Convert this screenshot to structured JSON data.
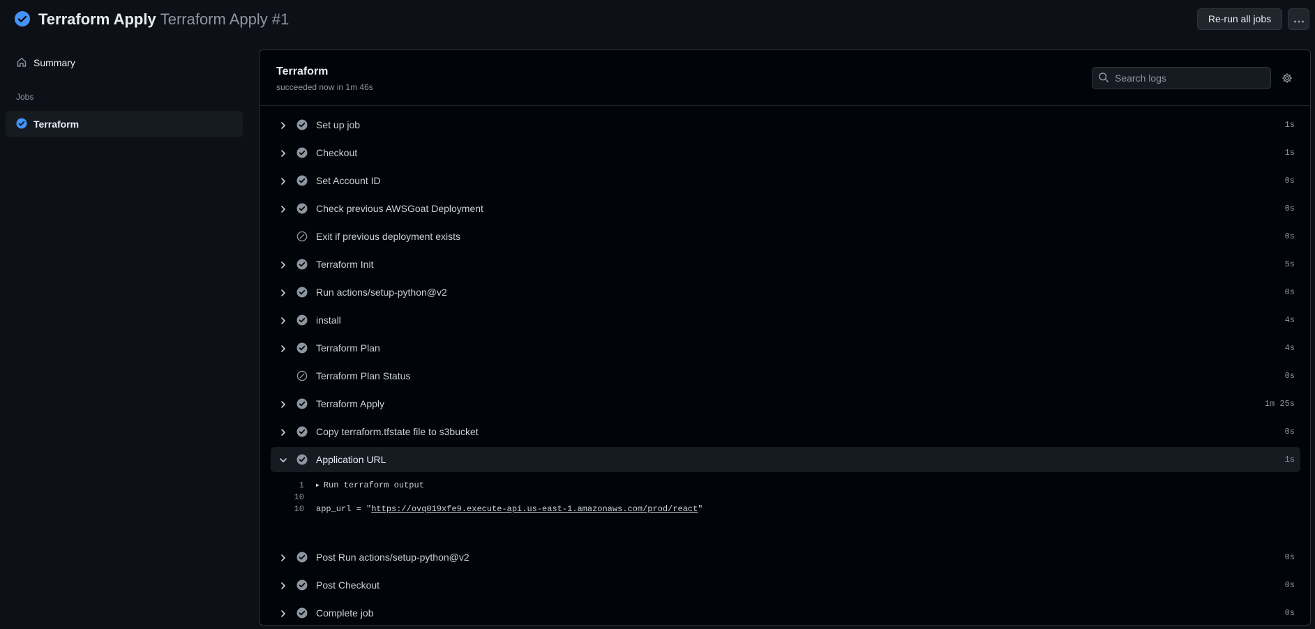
{
  "header": {
    "workflow_name": "Terraform Apply",
    "run_name": "Terraform Apply #1",
    "rerun_label": "Re-run all jobs",
    "status_icon": "check-circle-fill-icon",
    "more_icon": "kebab-horizontal-icon"
  },
  "sidebar": {
    "summary_label": "Summary",
    "summary_icon": "home-icon",
    "jobs_heading": "Jobs",
    "job_label": "Terraform"
  },
  "job": {
    "title": "Terraform",
    "subtitle": "succeeded now in 1m 46s",
    "search_placeholder": "Search logs",
    "settings_icon": "gear-icon"
  },
  "colors": {
    "success_blue": "#4493f8",
    "step_check": "#8d96a0",
    "background": "#0d1117",
    "panel": "#010409"
  },
  "steps": [
    {
      "name": "Set up job",
      "duration": "1s",
      "status": "success",
      "expanded": false
    },
    {
      "name": "Checkout",
      "duration": "1s",
      "status": "success",
      "expanded": false
    },
    {
      "name": "Set Account ID",
      "duration": "0s",
      "status": "success",
      "expanded": false
    },
    {
      "name": "Check previous AWSGoat Deployment",
      "duration": "0s",
      "status": "success",
      "expanded": false
    },
    {
      "name": "Exit if previous deployment exists",
      "duration": "0s",
      "status": "skipped",
      "expanded": false
    },
    {
      "name": "Terraform Init",
      "duration": "5s",
      "status": "success",
      "expanded": false
    },
    {
      "name": "Run actions/setup-python@v2",
      "duration": "0s",
      "status": "success",
      "expanded": false
    },
    {
      "name": "install",
      "duration": "4s",
      "status": "success",
      "expanded": false
    },
    {
      "name": "Terraform Plan",
      "duration": "4s",
      "status": "success",
      "expanded": false
    },
    {
      "name": "Terraform Plan Status",
      "duration": "0s",
      "status": "skipped",
      "expanded": false
    },
    {
      "name": "Terraform Apply",
      "duration": "1m 25s",
      "status": "success",
      "expanded": false
    },
    {
      "name": "Copy terraform.tfstate file to s3bucket",
      "duration": "0s",
      "status": "success",
      "expanded": false
    },
    {
      "name": "Application URL",
      "duration": "1s",
      "status": "success",
      "expanded": true
    },
    {
      "name": "Post Run actions/setup-python@v2",
      "duration": "0s",
      "status": "success",
      "expanded": false
    },
    {
      "name": "Post Checkout",
      "duration": "0s",
      "status": "success",
      "expanded": false
    },
    {
      "name": "Complete job",
      "duration": "0s",
      "status": "success",
      "expanded": false
    }
  ],
  "log": [
    {
      "line": "1",
      "text": "Run terraform output",
      "collapsible": true
    },
    {
      "line": "10",
      "text": ""
    },
    {
      "line": "10",
      "prefix": "app_url = \"",
      "link": "https://ovq019xfe9.execute-api.us-east-1.amazonaws.com/prod/react",
      "suffix": "\""
    }
  ]
}
